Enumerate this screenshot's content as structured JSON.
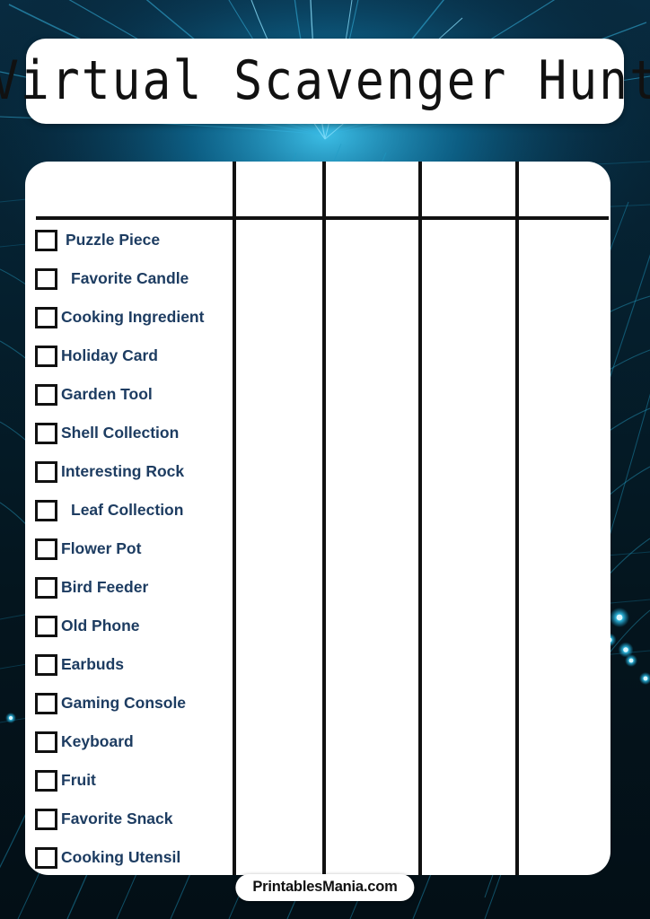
{
  "page": {
    "title": "Virtual Scavenger Hunt",
    "background_color": "#04141c",
    "accent_color": "#1bb8e0",
    "text_color": "#1d3c61",
    "card_color": "#ffffff",
    "line_color": "#111111"
  },
  "header": {
    "title": "Virtual Scavenger Hunt"
  },
  "table": {
    "column_count": 5,
    "header_row_labels": [
      "",
      "",
      "",
      "",
      ""
    ],
    "items": [
      {
        "label": "Puzzle Piece",
        "checked": false,
        "indent": "medium"
      },
      {
        "label": "Favorite Candle",
        "checked": false,
        "indent": "wide"
      },
      {
        "label": "Cooking Ingredient",
        "checked": false,
        "indent": "narrow"
      },
      {
        "label": "Holiday Card",
        "checked": false,
        "indent": "narrow"
      },
      {
        "label": "Garden Tool",
        "checked": false,
        "indent": "narrow"
      },
      {
        "label": "Shell Collection",
        "checked": false,
        "indent": "narrow"
      },
      {
        "label": "Interesting Rock",
        "checked": false,
        "indent": "narrow"
      },
      {
        "label": "Leaf Collection",
        "checked": false,
        "indent": "wide"
      },
      {
        "label": "Flower Pot",
        "checked": false,
        "indent": "narrow"
      },
      {
        "label": "Bird Feeder",
        "checked": false,
        "indent": "narrow"
      },
      {
        "label": "Old Phone",
        "checked": false,
        "indent": "narrow"
      },
      {
        "label": "Earbuds",
        "checked": false,
        "indent": "narrow"
      },
      {
        "label": "Gaming Console",
        "checked": false,
        "indent": "narrow"
      },
      {
        "label": "Keyboard",
        "checked": false,
        "indent": "narrow"
      },
      {
        "label": "Fruit",
        "checked": false,
        "indent": "narrow"
      },
      {
        "label": "Favorite Snack",
        "checked": false,
        "indent": "narrow"
      },
      {
        "label": "Cooking Utensil",
        "checked": false,
        "indent": "narrow"
      }
    ]
  },
  "footer": {
    "badge_label": "PrintablesMania.com"
  }
}
